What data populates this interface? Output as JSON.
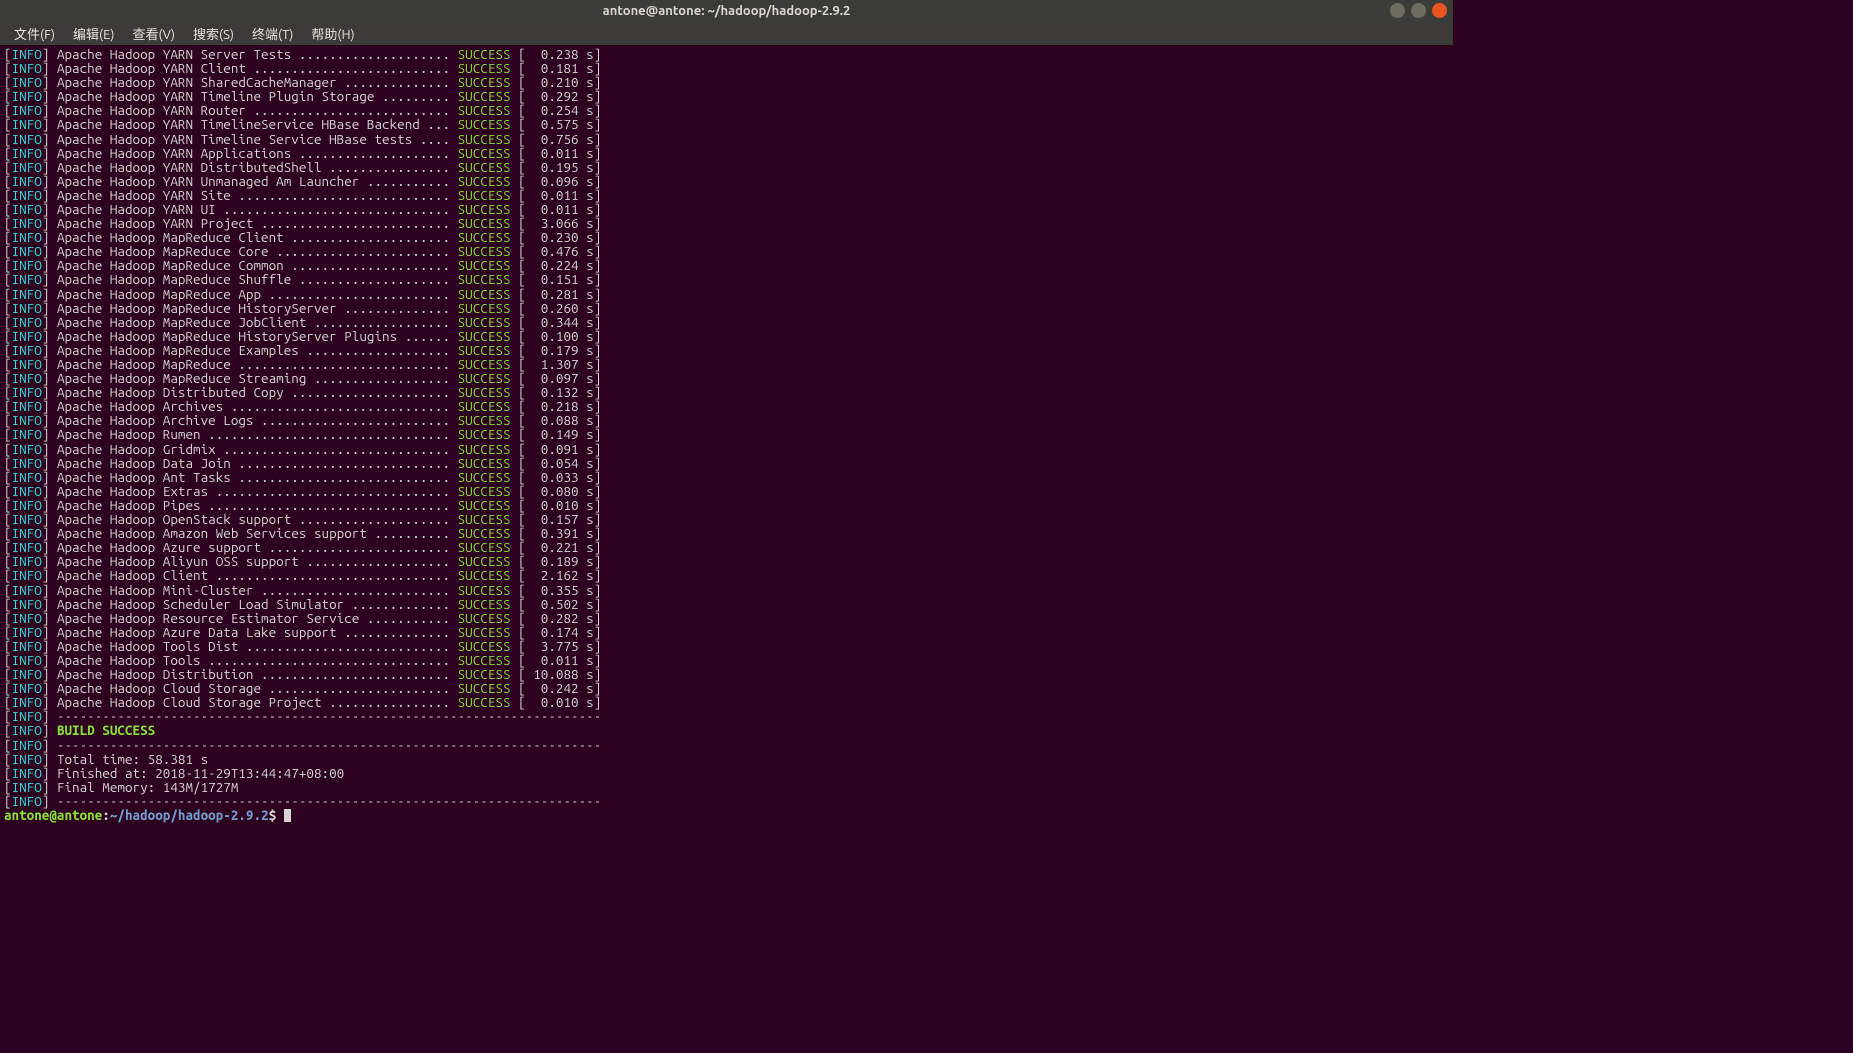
{
  "window": {
    "title": "antone@antone: ~/hadoop/hadoop-2.9.2"
  },
  "menubar": {
    "items": [
      "文件(F)",
      "编辑(E)",
      "查看(V)",
      "搜索(S)",
      "终端(T)",
      "帮助(H)"
    ]
  },
  "build": {
    "tag": "INFO",
    "status": "SUCCESS",
    "separator": "------------------------------------------------------------------------",
    "projects": [
      {
        "name": "Apache Hadoop YARN Server Tests",
        "time": "  0.238 s"
      },
      {
        "name": "Apache Hadoop YARN Client",
        "time": "  0.181 s"
      },
      {
        "name": "Apache Hadoop YARN SharedCacheManager",
        "time": "  0.210 s"
      },
      {
        "name": "Apache Hadoop YARN Timeline Plugin Storage",
        "time": "  0.292 s"
      },
      {
        "name": "Apache Hadoop YARN Router",
        "time": "  0.254 s"
      },
      {
        "name": "Apache Hadoop YARN TimelineService HBase Backend",
        "time": "  0.575 s"
      },
      {
        "name": "Apache Hadoop YARN Timeline Service HBase tests",
        "time": "  0.756 s"
      },
      {
        "name": "Apache Hadoop YARN Applications",
        "time": "  0.011 s"
      },
      {
        "name": "Apache Hadoop YARN DistributedShell",
        "time": "  0.195 s"
      },
      {
        "name": "Apache Hadoop YARN Unmanaged Am Launcher",
        "time": "  0.096 s"
      },
      {
        "name": "Apache Hadoop YARN Site",
        "time": "  0.011 s"
      },
      {
        "name": "Apache Hadoop YARN UI",
        "time": "  0.011 s"
      },
      {
        "name": "Apache Hadoop YARN Project",
        "time": "  3.066 s"
      },
      {
        "name": "Apache Hadoop MapReduce Client",
        "time": "  0.230 s"
      },
      {
        "name": "Apache Hadoop MapReduce Core",
        "time": "  0.476 s"
      },
      {
        "name": "Apache Hadoop MapReduce Common",
        "time": "  0.224 s"
      },
      {
        "name": "Apache Hadoop MapReduce Shuffle",
        "time": "  0.151 s"
      },
      {
        "name": "Apache Hadoop MapReduce App",
        "time": "  0.281 s"
      },
      {
        "name": "Apache Hadoop MapReduce HistoryServer",
        "time": "  0.260 s"
      },
      {
        "name": "Apache Hadoop MapReduce JobClient",
        "time": "  0.344 s"
      },
      {
        "name": "Apache Hadoop MapReduce HistoryServer Plugins",
        "time": "  0.100 s"
      },
      {
        "name": "Apache Hadoop MapReduce Examples",
        "time": "  0.179 s"
      },
      {
        "name": "Apache Hadoop MapReduce",
        "time": "  1.307 s"
      },
      {
        "name": "Apache Hadoop MapReduce Streaming",
        "time": "  0.097 s"
      },
      {
        "name": "Apache Hadoop Distributed Copy",
        "time": "  0.132 s"
      },
      {
        "name": "Apache Hadoop Archives",
        "time": "  0.218 s"
      },
      {
        "name": "Apache Hadoop Archive Logs",
        "time": "  0.088 s"
      },
      {
        "name": "Apache Hadoop Rumen",
        "time": "  0.149 s"
      },
      {
        "name": "Apache Hadoop Gridmix",
        "time": "  0.091 s"
      },
      {
        "name": "Apache Hadoop Data Join",
        "time": "  0.054 s"
      },
      {
        "name": "Apache Hadoop Ant Tasks",
        "time": "  0.033 s"
      },
      {
        "name": "Apache Hadoop Extras",
        "time": "  0.080 s"
      },
      {
        "name": "Apache Hadoop Pipes",
        "time": "  0.010 s"
      },
      {
        "name": "Apache Hadoop OpenStack support",
        "time": "  0.157 s"
      },
      {
        "name": "Apache Hadoop Amazon Web Services support",
        "time": "  0.391 s"
      },
      {
        "name": "Apache Hadoop Azure support",
        "time": "  0.221 s"
      },
      {
        "name": "Apache Hadoop Aliyun OSS support",
        "time": "  0.189 s"
      },
      {
        "name": "Apache Hadoop Client",
        "time": "  2.162 s"
      },
      {
        "name": "Apache Hadoop Mini-Cluster",
        "time": "  0.355 s"
      },
      {
        "name": "Apache Hadoop Scheduler Load Simulator",
        "time": "  0.502 s"
      },
      {
        "name": "Apache Hadoop Resource Estimator Service",
        "time": "  0.282 s"
      },
      {
        "name": "Apache Hadoop Azure Data Lake support",
        "time": "  0.174 s"
      },
      {
        "name": "Apache Hadoop Tools Dist",
        "time": "  3.775 s"
      },
      {
        "name": "Apache Hadoop Tools",
        "time": "  0.011 s"
      },
      {
        "name": "Apache Hadoop Distribution",
        "time": " 10.088 s"
      },
      {
        "name": "Apache Hadoop Cloud Storage",
        "time": "  0.242 s"
      },
      {
        "name": "Apache Hadoop Cloud Storage Project",
        "time": "  0.010 s"
      }
    ],
    "summary": {
      "build_success": "BUILD SUCCESS",
      "total_time": "Total time: 58.381 s",
      "finished_at": "Finished at: 2018-11-29T13:44:47+08:00",
      "final_memory": "Final Memory: 143M/1727M"
    }
  },
  "prompt": {
    "user_host": "antone@antone",
    "separator": ":",
    "path": "~/hadoop/hadoop-2.9.2",
    "symbol": "$"
  }
}
